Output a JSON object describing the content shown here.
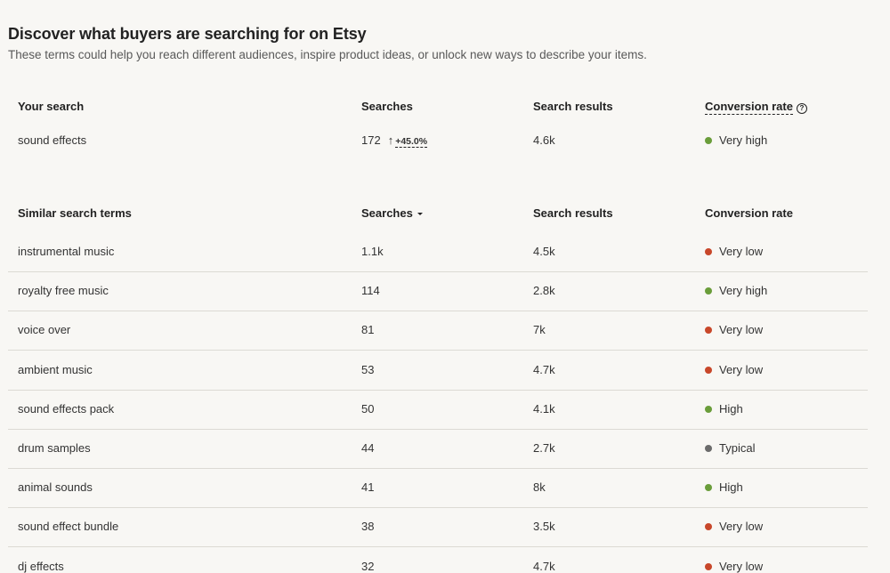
{
  "header": {
    "title": "Discover what buyers are searching for on Etsy",
    "subtitle": "These terms could help you reach different audiences, inspire product ideas, or unlock new ways to describe your items."
  },
  "your_search": {
    "columns": {
      "term": "Your search",
      "searches": "Searches",
      "results": "Search results",
      "conversion": "Conversion rate"
    },
    "help_icon": "question-circle-icon",
    "row": {
      "term": "sound effects",
      "searches": "172",
      "trend_arrow": "↑",
      "trend": "+45.0%",
      "results": "4.6k",
      "conversion": "Very high",
      "conversion_color": "#6a9d3a"
    }
  },
  "similar": {
    "columns": {
      "term": "Similar search terms",
      "searches": "Searches",
      "results": "Search results",
      "conversion": "Conversion rate"
    },
    "sort_icon": "caret-down-icon",
    "rows": [
      {
        "term": "instrumental music",
        "searches": "1.1k",
        "results": "4.5k",
        "conversion": "Very low",
        "color": "#c8472a"
      },
      {
        "term": "royalty free music",
        "searches": "114",
        "results": "2.8k",
        "conversion": "Very high",
        "color": "#6a9d3a"
      },
      {
        "term": "voice over",
        "searches": "81",
        "results": "7k",
        "conversion": "Very low",
        "color": "#c8472a"
      },
      {
        "term": "ambient music",
        "searches": "53",
        "results": "4.7k",
        "conversion": "Very low",
        "color": "#c8472a"
      },
      {
        "term": "sound effects pack",
        "searches": "50",
        "results": "4.1k",
        "conversion": "High",
        "color": "#6a9d3a"
      },
      {
        "term": "drum samples",
        "searches": "44",
        "results": "2.7k",
        "conversion": "Typical",
        "color": "#6b6b6b"
      },
      {
        "term": "animal sounds",
        "searches": "41",
        "results": "8k",
        "conversion": "High",
        "color": "#6a9d3a"
      },
      {
        "term": "sound effect bundle",
        "searches": "38",
        "results": "3.5k",
        "conversion": "Very low",
        "color": "#c8472a"
      },
      {
        "term": "dj effects",
        "searches": "32",
        "results": "4.7k",
        "conversion": "Very low",
        "color": "#c8472a"
      }
    ]
  }
}
